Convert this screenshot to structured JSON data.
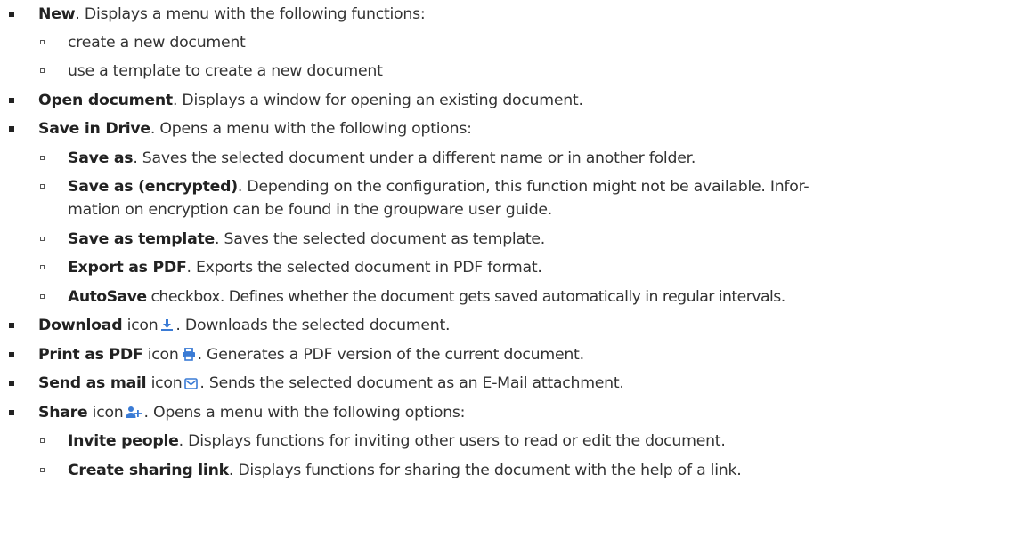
{
  "items": [
    {
      "bold": "New",
      "text": ". Displays a menu with the following functions:",
      "children": [
        {
          "bold": "",
          "text": "create a new document"
        },
        {
          "bold": "",
          "text": "use a template to create a new document"
        }
      ]
    },
    {
      "bold": "Open document",
      "text": ". Displays a window for opening an existing document."
    },
    {
      "bold": "Save in Drive",
      "text": ". Opens a menu with the following options:",
      "children": [
        {
          "bold": "Save as",
          "text": ". Saves the selected document under a different name or in another folder."
        },
        {
          "bold": "Save as (encrypted)",
          "text": ". Depending on the configuration, this function might not be available. Information on encryption can be found in the groupware user guide.",
          "line1": ". Depending on the configuration, this function might not be available. Infor-",
          "line2": "mation on encryption can be found in the groupware user guide."
        },
        {
          "bold": "Save as template",
          "text": ". Saves the selected document as template."
        },
        {
          "bold": "Export as PDF",
          "text": ". Exports the selected document in PDF format."
        },
        {
          "bold": "AutoSave",
          "text": " checkbox. Defines whether the document gets saved automatically in regular intervals."
        }
      ]
    },
    {
      "bold": "Download",
      "word": " icon",
      "icon": "download-icon",
      "text": ". Downloads the selected document."
    },
    {
      "bold": "Print as PDF",
      "word": " icon",
      "icon": "print-icon",
      "text": ". Generates a PDF version of the current document."
    },
    {
      "bold": "Send as mail",
      "word": " icon",
      "icon": "mail-icon",
      "text": ". Sends the selected document as an E-Mail attachment."
    },
    {
      "bold": "Share",
      "word": " icon",
      "icon": "add-user-icon",
      "text": ". Opens a menu with the following options:",
      "children": [
        {
          "bold": "Invite people",
          "text": ". Displays functions for inviting other users to read or edit the document."
        },
        {
          "bold": "Create sharing link",
          "text": ". Displays functions for sharing the document with the help of a link."
        }
      ]
    }
  ],
  "colors": {
    "text": "#333333",
    "bold": "#222222",
    "icon": "#3a7bd5"
  }
}
